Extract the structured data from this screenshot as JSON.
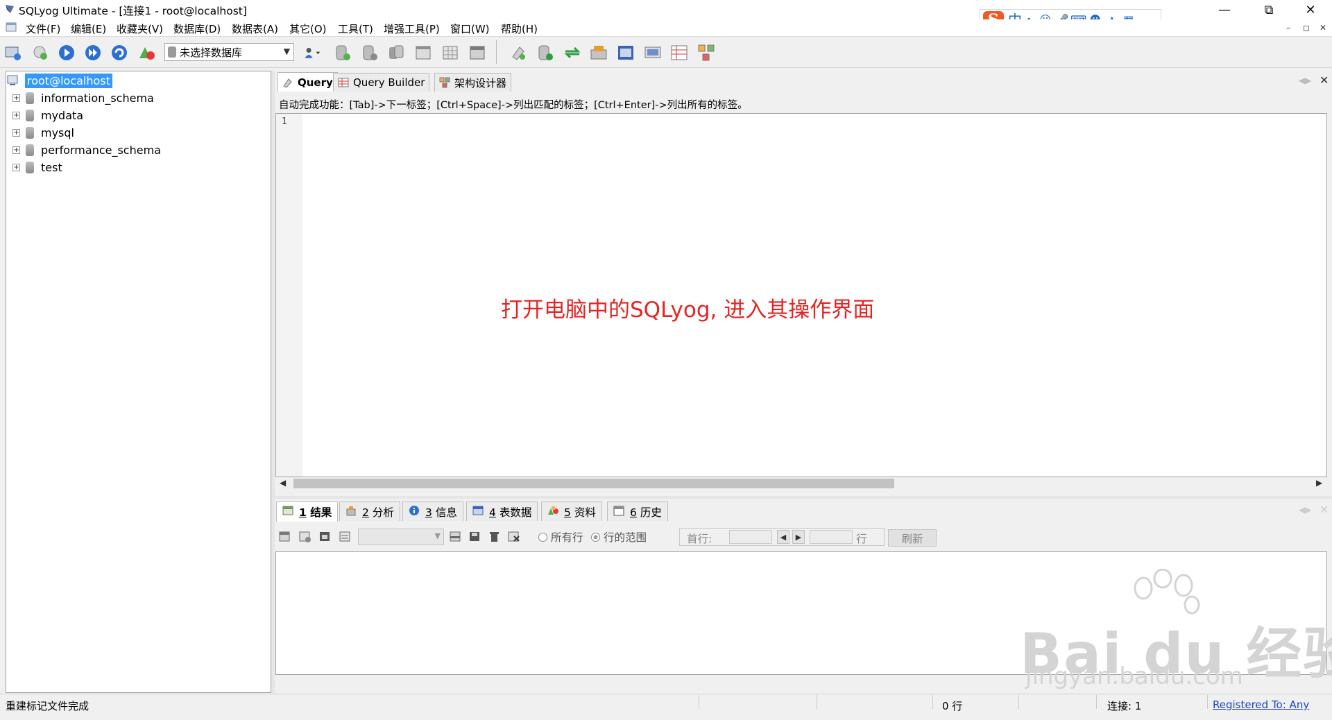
{
  "window": {
    "title": "SQLyog Ultimate - [连接1 - root@localhost]"
  },
  "ime": {
    "logo": "S",
    "mode": "中",
    "punct": "•,"
  },
  "menu": {
    "items": [
      "文件(F)",
      "编辑(E)",
      "收藏夹(V)",
      "数据库(D)",
      "数据表(A)",
      "其它(O)",
      "工具(T)",
      "增强工具(P)",
      "窗口(W)",
      "帮助(H)"
    ]
  },
  "toolbar": {
    "database_select": "未选择数据库"
  },
  "object_browser": {
    "root": "root@localhost",
    "databases": [
      "information_schema",
      "mydata",
      "mysql",
      "performance_schema",
      "test"
    ]
  },
  "editor": {
    "tabs": [
      "Query",
      "Query Builder",
      "架构设计器"
    ],
    "hint": "自动完成功能：[Tab]->下一标签；[Ctrl+Space]->列出匹配的标签；[Ctrl+Enter]->列出所有的标签。",
    "line_number": "1",
    "annotation": "打开电脑中的SQLyog, 进入其操作界面"
  },
  "results": {
    "tabs": [
      {
        "num": "1",
        "label": "结果"
      },
      {
        "num": "2",
        "label": "分析"
      },
      {
        "num": "3",
        "label": "信息"
      },
      {
        "num": "4",
        "label": "表数据"
      },
      {
        "num": "5",
        "label": "资料"
      },
      {
        "num": "6",
        "label": "历史"
      }
    ],
    "radio_all_rows": "所有行",
    "radio_row_range": "行的范围",
    "first_row_label": "首行:",
    "rows_label": "行",
    "refresh": "刷新"
  },
  "status": {
    "message": "重建标记文件完成",
    "rows": "0 行",
    "connection": "连接: 1",
    "registered": "Registered To: Any"
  },
  "watermark": {
    "brand": "Bai du 经验",
    "url": "jingyan.baidu.com"
  },
  "colors": {
    "selection": "#3399ff",
    "annotation": "#e32525",
    "link": "#1a44c2"
  }
}
